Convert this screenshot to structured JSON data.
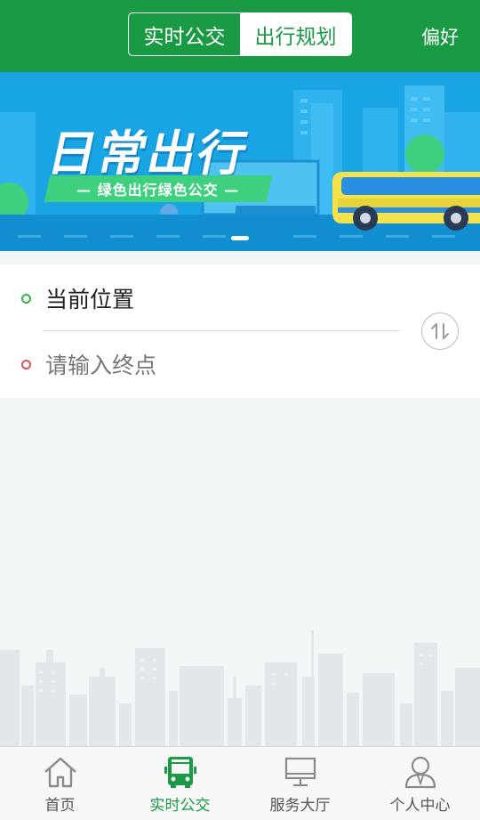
{
  "header": {
    "tabs": [
      {
        "label": "实时公交",
        "active": false
      },
      {
        "label": "出行规划",
        "active": true
      }
    ],
    "preference_label": "偏好"
  },
  "banner": {
    "title": "日常出行",
    "subtitle": "— 绿色出行绿色公交 —",
    "slide_count_visible": 1,
    "active_slide": 1
  },
  "route": {
    "from_value": "当前位置",
    "to_placeholder": "请输入终点",
    "swap_icon": "swap-vertical-icon"
  },
  "bottom_nav": {
    "items": [
      {
        "label": "首页",
        "icon": "home-icon",
        "active": false
      },
      {
        "label": "实时公交",
        "icon": "bus-icon",
        "active": true
      },
      {
        "label": "服务大厅",
        "icon": "monitor-icon",
        "active": false
      },
      {
        "label": "个人中心",
        "icon": "user-icon",
        "active": false
      }
    ]
  },
  "colors": {
    "brand_green": "#1a9a45",
    "banner_blue": "#19a4e3",
    "from_dot": "#35b545",
    "to_dot": "#e0505a",
    "page_bg": "#f3f6f7"
  }
}
